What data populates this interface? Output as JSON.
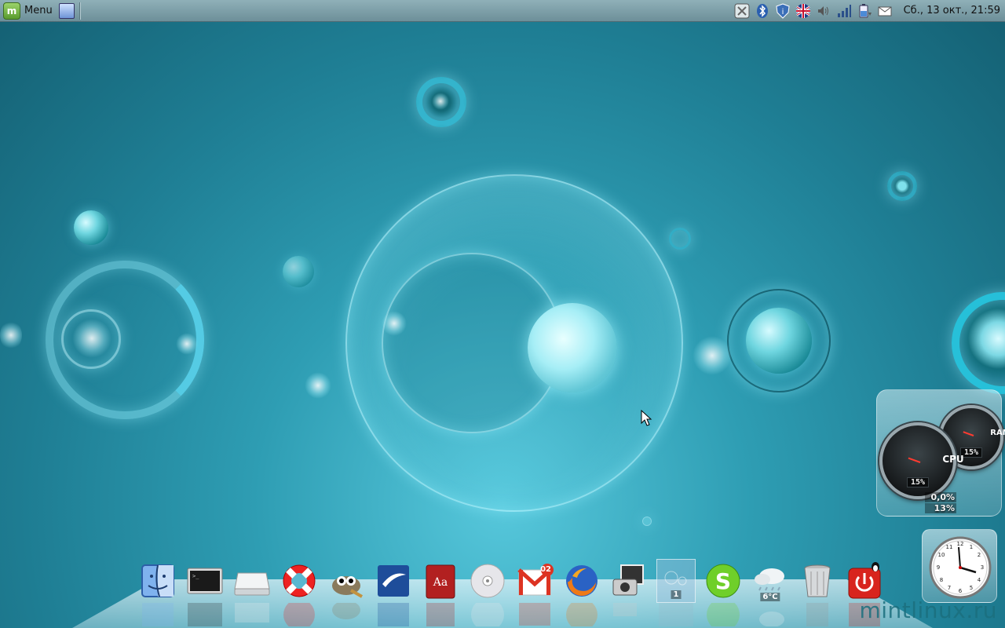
{
  "top_panel": {
    "menu_label": "Menu",
    "clock": "Сб., 13 окт., 21:59"
  },
  "tray_icons": [
    "network-manager-icon",
    "bluetooth-icon",
    "update-shield-icon",
    "keyboard-layout-flag-icon",
    "volume-icon",
    "signal-icon",
    "battery-icon",
    "mail-icon"
  ],
  "sysmon": {
    "cpu_label": "CPU",
    "cpu_value": "15%",
    "ram_label": "RAM",
    "ram_value": "15%",
    "extra_1": "0,0%",
    "extra_2": "13%"
  },
  "dock": {
    "workspace_number": "1",
    "weather_temp": "6°C",
    "mail_count": "02",
    "items": [
      "finder-icon",
      "terminal-icon",
      "drive-icon",
      "help-lifebuoy-icon",
      "gimp-icon",
      "office-writer-icon",
      "dictionary-icon",
      "cd-disc-icon",
      "gmail-icon",
      "firefox-icon",
      "screenshot-camera-icon",
      "workspace-switcher-icon",
      "skype-icon",
      "weather-icon",
      "trash-icon",
      "power-icon"
    ]
  },
  "watermark": "mintlinux.ru",
  "colors": {
    "wallpaper_mid": "#2e9db3",
    "panel": "#7fa1aa",
    "bubble": "#6fd6e0"
  }
}
